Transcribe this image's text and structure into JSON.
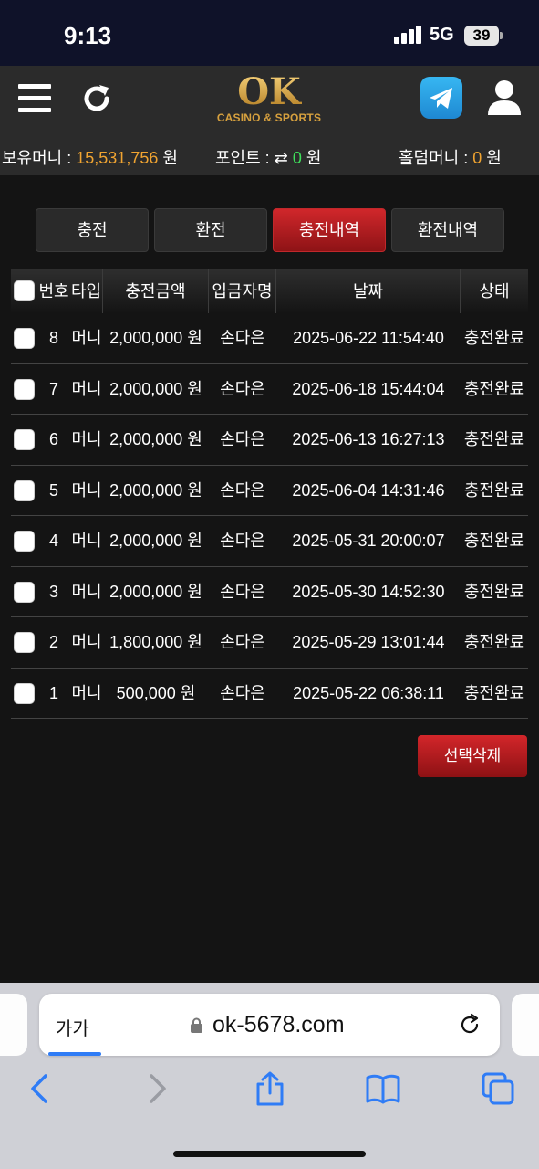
{
  "status_bar": {
    "time": "9:13",
    "network": "5G",
    "battery": "39"
  },
  "header": {
    "logo_text": "OK",
    "logo_sub": "CASINO & SPORTS"
  },
  "balances": {
    "holding_label": "보유머니 :",
    "holding_value": "15,531,756",
    "holding_unit": "원",
    "point_label": "포인트 :",
    "point_value": "0",
    "point_unit": "원",
    "holdem_label": "홀덤머니 :",
    "holdem_value": "0",
    "holdem_unit": "원"
  },
  "tabs": [
    {
      "label": "충전",
      "active": false
    },
    {
      "label": "환전",
      "active": false
    },
    {
      "label": "충전내역",
      "active": true
    },
    {
      "label": "환전내역",
      "active": false
    }
  ],
  "table": {
    "headers": {
      "no": "번호",
      "type": "타입",
      "amount": "충전금액",
      "depositor": "입금자명",
      "date": "날짜",
      "status": "상태"
    },
    "rows": [
      {
        "no": "8",
        "type": "머니",
        "amount": "2,000,000 원",
        "depositor": "손다은",
        "date": "2025-06-22 11:54:40",
        "status": "충전완료"
      },
      {
        "no": "7",
        "type": "머니",
        "amount": "2,000,000 원",
        "depositor": "손다은",
        "date": "2025-06-18 15:44:04",
        "status": "충전완료"
      },
      {
        "no": "6",
        "type": "머니",
        "amount": "2,000,000 원",
        "depositor": "손다은",
        "date": "2025-06-13 16:27:13",
        "status": "충전완료"
      },
      {
        "no": "5",
        "type": "머니",
        "amount": "2,000,000 원",
        "depositor": "손다은",
        "date": "2025-06-04 14:31:46",
        "status": "충전완료"
      },
      {
        "no": "4",
        "type": "머니",
        "amount": "2,000,000 원",
        "depositor": "손다은",
        "date": "2025-05-31 20:00:07",
        "status": "충전완료"
      },
      {
        "no": "3",
        "type": "머니",
        "amount": "2,000,000 원",
        "depositor": "손다은",
        "date": "2025-05-30 14:52:30",
        "status": "충전완료"
      },
      {
        "no": "2",
        "type": "머니",
        "amount": "1,800,000 원",
        "depositor": "손다은",
        "date": "2025-05-29 13:01:44",
        "status": "충전완료"
      },
      {
        "no": "1",
        "type": "머니",
        "amount": "500,000 원",
        "depositor": "손다은",
        "date": "2025-05-22 06:38:11",
        "status": "충전완료"
      }
    ]
  },
  "delete_button": "선택삭제",
  "browser": {
    "aa_label": "가가",
    "url": "ok-5678.com"
  },
  "colors": {
    "accent_red": "#c8262a",
    "money_orange": "#f0a431",
    "point_green": "#3ee05a",
    "logo_gold": "#d9a441"
  },
  "icons": [
    "hamburger-menu-icon",
    "refresh-icon",
    "telegram-icon",
    "user-icon",
    "lock-icon",
    "reload-icon",
    "back-icon",
    "forward-icon",
    "share-icon",
    "bookmarks-icon",
    "tabs-icon",
    "transfer-arrows-icon"
  ]
}
